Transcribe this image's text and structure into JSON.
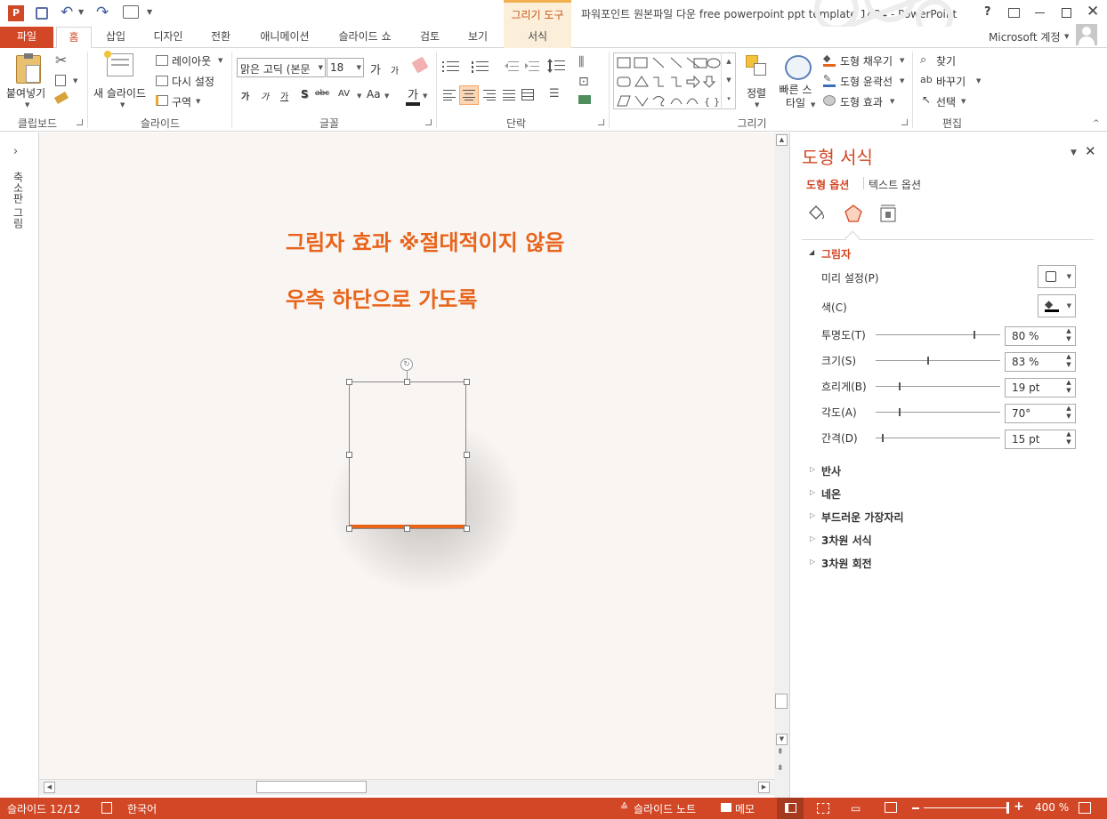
{
  "window": {
    "title": "파워포인트 원본파일 다운 free powerpoint ppt template 1484 - PowerPoint",
    "context_tab_group": "그리기 도구",
    "help": "?",
    "account": "Microsoft 계정"
  },
  "tabs": [
    "파일",
    "홈",
    "삽입",
    "디자인",
    "전환",
    "애니메이션",
    "슬라이드 쇼",
    "검토",
    "보기",
    "서식"
  ],
  "ribbon": {
    "clipboard": {
      "paste": "붙여넣기",
      "label": "클립보드"
    },
    "slides": {
      "new_slide": "새 슬라이드",
      "layout": "레이아웃",
      "reset": "다시 설정",
      "section": "구역",
      "label": "슬라이드"
    },
    "font": {
      "name": "맑은 고딕 (본문",
      "size": "18",
      "bold": "가",
      "italic": "가",
      "underline": "가",
      "shadow": "S",
      "strike": "abc",
      "spacing": "AV",
      "case": "Aa",
      "color": "가",
      "grow": "가",
      "shrink": "가",
      "label": "글꼴"
    },
    "paragraph": {
      "label": "단락"
    },
    "drawing": {
      "arrange": "정렬",
      "quick_styles": "빠른 스타일",
      "fill": "도형 채우기",
      "outline": "도형 윤곽선",
      "effects": "도형 효과",
      "label": "그리기"
    },
    "editing": {
      "find": "찾기",
      "replace": "바꾸기",
      "select": "선택",
      "label": "편집"
    }
  },
  "left_panel": {
    "label": "축소판 그림"
  },
  "slide": {
    "line1": "그림자 효과 ※절대적이지 않음",
    "line2": "우측 하단으로 가도록",
    "accent_color": "#e8641b"
  },
  "format_pane": {
    "title": "도형 서식",
    "tab_shape": "도형 옵션",
    "tab_text": "텍스트 옵션",
    "section_shadow": "그림자",
    "presets_label": "미리 설정(P)",
    "color_label": "색(C)",
    "rows": [
      {
        "label": "투명도(T)",
        "value": "80 %",
        "level": 0.8
      },
      {
        "label": "크기(S)",
        "value": "83 %",
        "level": 0.42
      },
      {
        "label": "흐리게(B)",
        "value": "19 pt",
        "level": 0.19
      },
      {
        "label": "각도(A)",
        "value": "70°",
        "level": 0.19
      },
      {
        "label": "간격(D)",
        "value": "15 pt",
        "level": 0.05
      }
    ],
    "collapsed": [
      "반사",
      "네온",
      "부드러운 가장자리",
      "3차원 서식",
      "3차원 회전"
    ]
  },
  "status": {
    "slide": "슬라이드 12/12",
    "language": "한국어",
    "notes": "슬라이드 노트",
    "comments": "메모",
    "zoom": "400 %"
  }
}
